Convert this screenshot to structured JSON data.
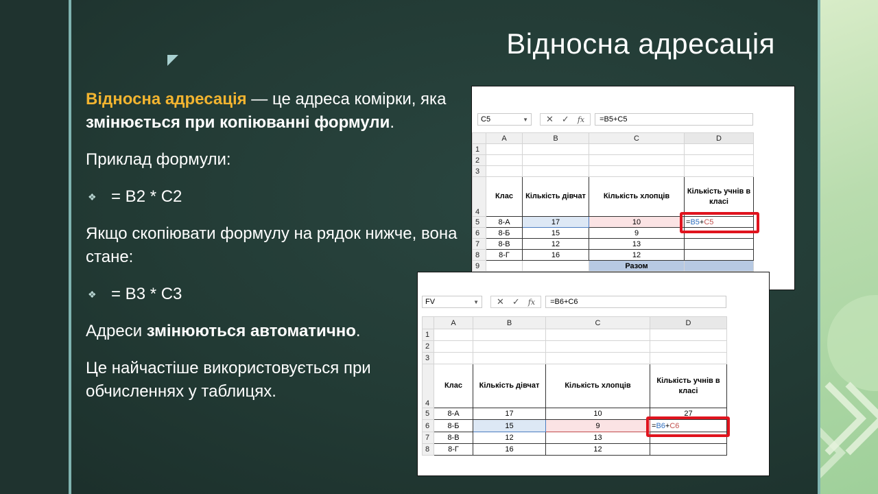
{
  "slide": {
    "title": "Відносна адресація",
    "intro": {
      "term": "Відносна адресація",
      "rest1": " — це адреса комірки, яка ",
      "bold": "змінюється при копіюванні формули",
      "end": "."
    },
    "example_label": "Приклад формули:",
    "bullet1": "= B2 * C2",
    "copy_text": "Якщо скопіювати формулу на рядок нижче, вона стане:",
    "bullet2": "= B3 * C3",
    "auto": {
      "pre": "Адреси ",
      "bold": "змінюються автоматично",
      "end": "."
    },
    "usage": "Це найчастіше використовується при обчисленнях у таблицях."
  },
  "accent_color": "#F2B430",
  "bullet_icon": "diamond-four-icon",
  "excel1": {
    "name_box": "C5",
    "formula": "=B5+C5",
    "columns": [
      "A",
      "B",
      "C",
      "D"
    ],
    "rows": [
      "1",
      "2",
      "3",
      "4",
      "5",
      "6",
      "7",
      "8",
      "9"
    ],
    "headers": [
      "Клас",
      "Кількість  дівчат",
      "Кількість хлопців",
      "Кількість учнів в класі"
    ],
    "data": [
      [
        "8-А",
        "17",
        "10"
      ],
      [
        "8-Б",
        "15",
        "9"
      ],
      [
        "8-В",
        "12",
        "13"
      ],
      [
        "8-Г",
        "16",
        "12"
      ]
    ],
    "edit_formula": {
      "eq": "=",
      "b": "B5",
      "plus": "+",
      "c": "C5"
    },
    "total_label": "Разом"
  },
  "excel2": {
    "name_box": "FV",
    "formula": "=B6+C6",
    "columns": [
      "A",
      "B",
      "C",
      "D"
    ],
    "rows": [
      "1",
      "2",
      "3",
      "4",
      "5",
      "6",
      "7",
      "8"
    ],
    "headers": [
      "Клас",
      "Кількість  дівчат",
      "Кількість хлопців",
      "Кількість учнів в класі"
    ],
    "data": [
      [
        "8-А",
        "17",
        "10",
        "27"
      ],
      [
        "8-Б",
        "15",
        "9"
      ],
      [
        "8-В",
        "12",
        "13"
      ],
      [
        "8-Г",
        "16",
        "12"
      ]
    ],
    "edit_formula": {
      "eq": "=",
      "b": "B6",
      "plus": "+",
      "c": "C6"
    }
  }
}
